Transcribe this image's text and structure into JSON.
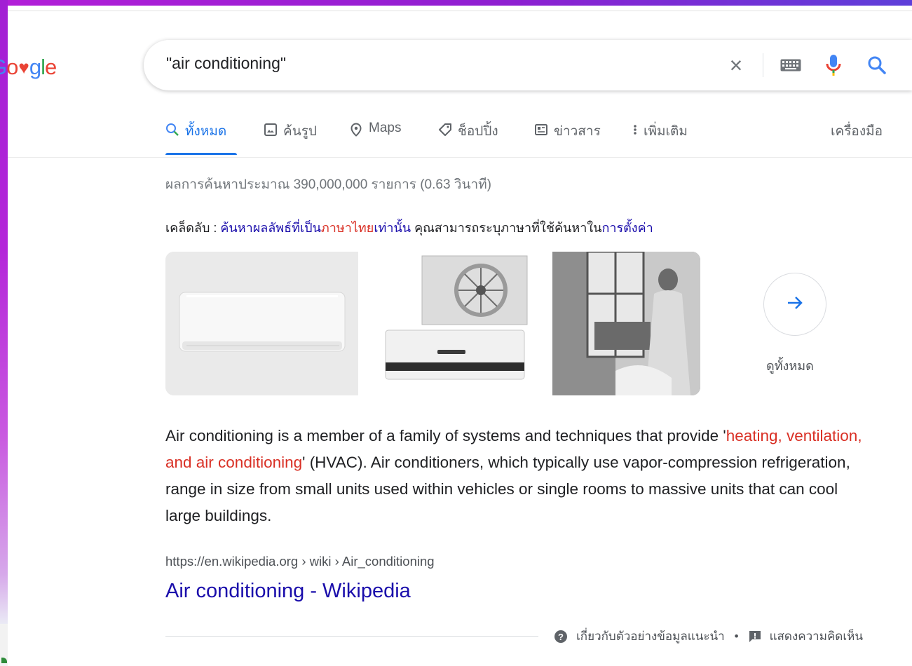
{
  "logo": {
    "g": "G",
    "o1": "o",
    "heart": "♥",
    "g2": "g",
    "l": "l",
    "e": "e"
  },
  "search": {
    "query": "\"air conditioning\""
  },
  "tabs": [
    {
      "label": "ทั้งหมด",
      "icon": "search-icon",
      "active": true
    },
    {
      "label": "ค้นรูป",
      "icon": "image-icon"
    },
    {
      "label": "Maps",
      "icon": "location-pin-icon"
    },
    {
      "label": "ช็อปปิ้ง",
      "icon": "tag-icon"
    },
    {
      "label": "ข่าวสาร",
      "icon": "news-icon"
    },
    {
      "label": "เพิ่มเติม",
      "icon": "more-vert-icon"
    }
  ],
  "tools_label": "เครื่องมือ",
  "result_stats": "ผลการค้นหาประมาณ 390,000,000 รายการ (0.63 วินาที)",
  "tip": {
    "prefix": "เคล็ดลับ : ",
    "link1": "ค้นหาผลลัพธ์ที่เป็น",
    "link_lang": "ภาษาไทย",
    "link2": "เท่านั้น",
    "middle": " คุณสามารถระบุภาษาที่ใช้ค้นหาใน",
    "settings_link": "การตั้งค่า"
  },
  "see_all_label": "ดูทั้งหมด",
  "snippet": {
    "part1": "Air conditioning is a member of a family of systems and techniques that provide '",
    "link": "heating, ventilation, and air conditioning",
    "part2": "' (HVAC). Air conditioners, which typically use vapor-compression refrigeration, range in size from small units used within vehicles or single rooms to massive units that can cool large buildings."
  },
  "result": {
    "cite": "https://en.wikipedia.org › wiki › Air_conditioning",
    "title": "Air conditioning - Wikipedia"
  },
  "footer": {
    "about": "เกี่ยวกับตัวอย่างข้อมูลแนะนำ",
    "separator": "•",
    "feedback": "แสดงความคิดเห็น"
  },
  "colors": {
    "accent": "#1a73e8",
    "link": "#1a0dab",
    "red_link": "#d93025",
    "frame": "#a21fd4"
  }
}
